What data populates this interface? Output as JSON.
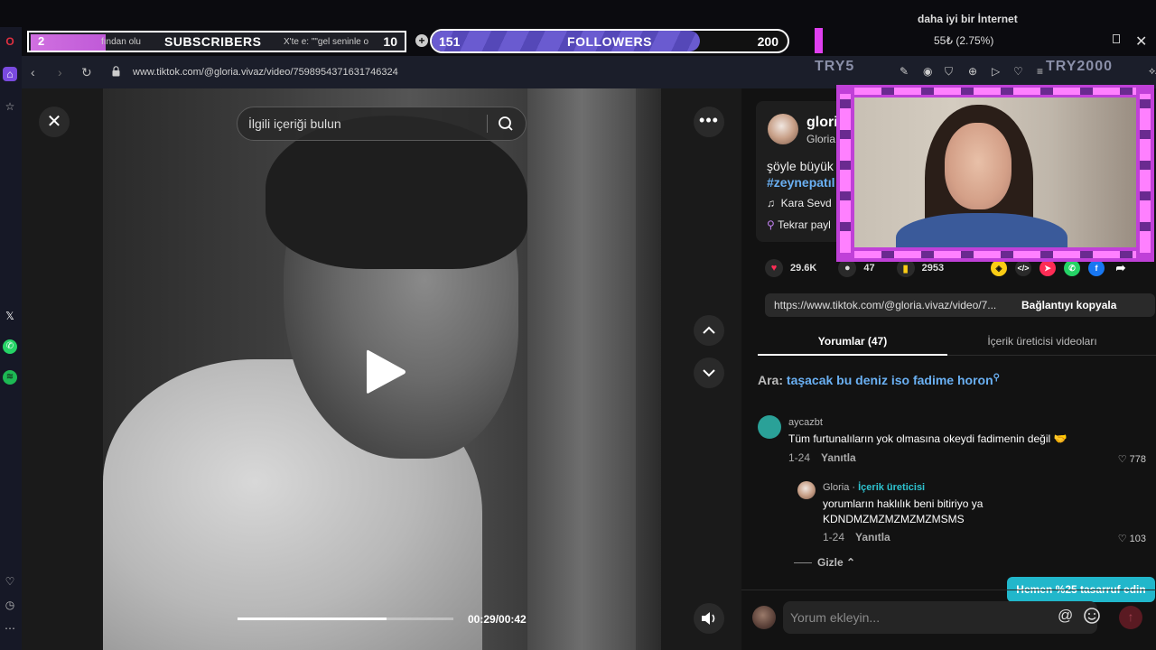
{
  "overlay": {
    "subscribers": {
      "count": "2",
      "label": "SUBSCRIBERS",
      "goal": "10",
      "progress": 0.2
    },
    "followers": {
      "count": "151",
      "label": "FOLLOWERS",
      "goal": "200",
      "progress": 0.755
    },
    "tabs": [
      "fından olu",
      "X'te e: \"\"gel seninle o"
    ],
    "price_text": "55₺ (2.75%)",
    "internet_text": "daha iyi bir İnternet",
    "try_left": "TRY5",
    "try_right": "TRY2000"
  },
  "browser": {
    "url": "www.tiktok.com/@gloria.vivaz/video/7598954371631746324",
    "ai_label": "AI"
  },
  "video": {
    "search_placeholder": "İlgili içeriği bulun",
    "time": "00:29/00:42",
    "progress": 0.69
  },
  "author": {
    "name": "glori",
    "sub": "Gloria",
    "desc": "şöyle büyük",
    "hashtag": "#zeynepatıl",
    "music": "Kara Sevd",
    "repost": "Tekrar payl"
  },
  "stats": {
    "likes": "29.6K",
    "comments": "47",
    "saves": "2953"
  },
  "link": {
    "url": "https://www.tiktok.com/@gloria.vivaz/video/7...",
    "copy_label": "Bağlantıyı kopyala"
  },
  "tabs": {
    "comments": "Yorumlar (47)",
    "creator_videos": "İçerik üreticisi videoları"
  },
  "related": {
    "prefix": "Ara:",
    "query": "taşacak bu deniz iso fadime horon"
  },
  "comments": [
    {
      "user": "aycazbt",
      "text": "Tüm furtunalıların yok olmasına okeydi fadimenin değil 🤝",
      "date": "1-24",
      "reply": "Yanıtla",
      "likes": "778"
    },
    {
      "user": "Gloria",
      "creator_tag": "İçerik üreticisi",
      "text": "yorumların haklılık beni bitiriyo ya KDNDMZMZMZMZMZMSMS",
      "date": "1-24",
      "reply": "Yanıtla",
      "likes": "103"
    }
  ],
  "hide_label": "Gizle",
  "comment_placeholder": "Yorum ekleyin...",
  "promo": "Hemen %25 tasarruf edin",
  "colors": {
    "accent_pink": "#fe2c55",
    "link_blue": "#6ab0f3",
    "creator_cyan": "#2ec3d0",
    "promo_bg": "#21b7cb",
    "overlay_magenta": "#c040d8"
  }
}
